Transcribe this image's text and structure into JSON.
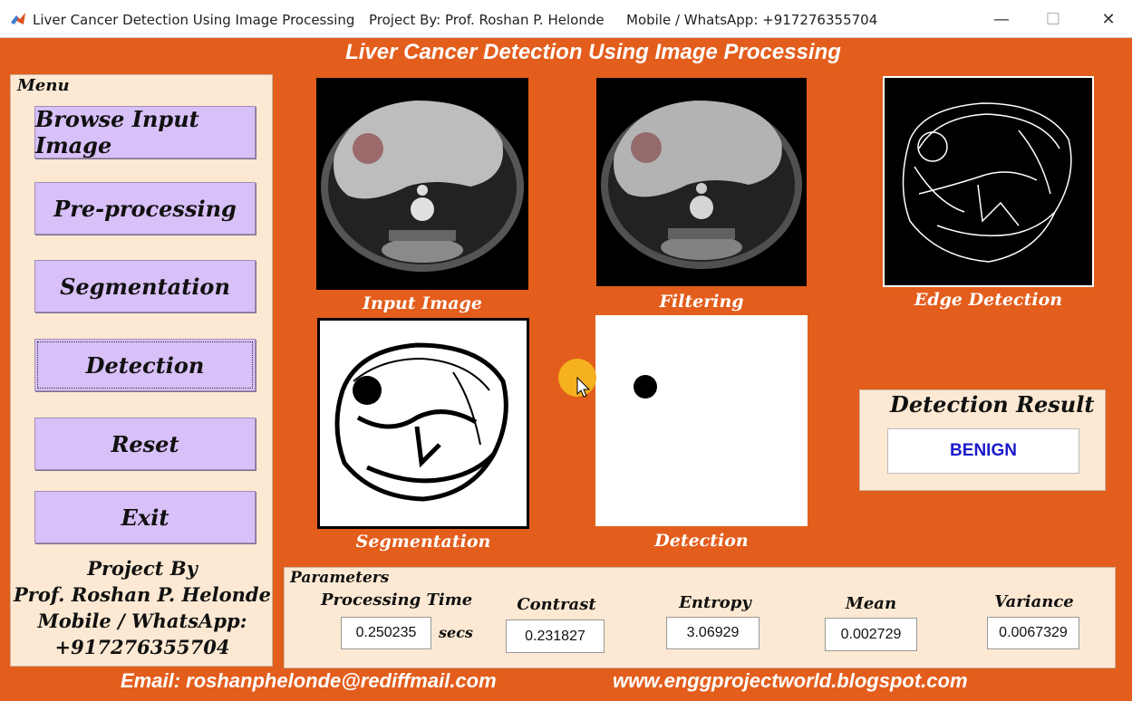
{
  "window": {
    "title": "Liver Cancer Detection Using Image Processing",
    "project_by": "Project By: Prof. Roshan P. Helonde",
    "mobile": "Mobile / WhatsApp: +917276355704",
    "controls": {
      "minimize": "—",
      "maximize": "☐",
      "close": "✕"
    }
  },
  "banner": "Liver Cancer Detection Using Image Processing",
  "menu": {
    "title": "Menu",
    "buttons": {
      "browse": "Browse Input Image",
      "preprocess": "Pre-processing",
      "segmentation": "Segmentation",
      "detection": "Detection",
      "reset": "Reset",
      "exit": "Exit"
    },
    "credits": {
      "line1": "Project By",
      "line2": "Prof. Roshan P. Helonde",
      "line3": "Mobile / WhatsApp:",
      "line4": "+917276355704"
    }
  },
  "images": {
    "input": "Input Image",
    "filtering": "Filtering",
    "edge": "Edge Detection",
    "segmentation": "Segmentation",
    "detection": "Detection"
  },
  "result": {
    "title": "Detection Result",
    "value": "BENIGN"
  },
  "parameters": {
    "title": "Parameters",
    "processing_time": {
      "label": "Processing Time",
      "value": "0.250235",
      "unit": "secs"
    },
    "contrast": {
      "label": "Contrast",
      "value": "0.231827"
    },
    "entropy": {
      "label": "Entropy",
      "value": "3.06929"
    },
    "mean": {
      "label": "Mean",
      "value": "0.002729"
    },
    "variance": {
      "label": "Variance",
      "value": "0.0067329"
    }
  },
  "footer": {
    "email": "Email: roshanphelonde@rediffmail.com",
    "website": "www.enggprojectworld.blogspot.com"
  },
  "colors": {
    "background": "#e35d1c",
    "panel": "#fde9d3",
    "button": "#d8c0f8",
    "result_text": "#1a1acc"
  }
}
